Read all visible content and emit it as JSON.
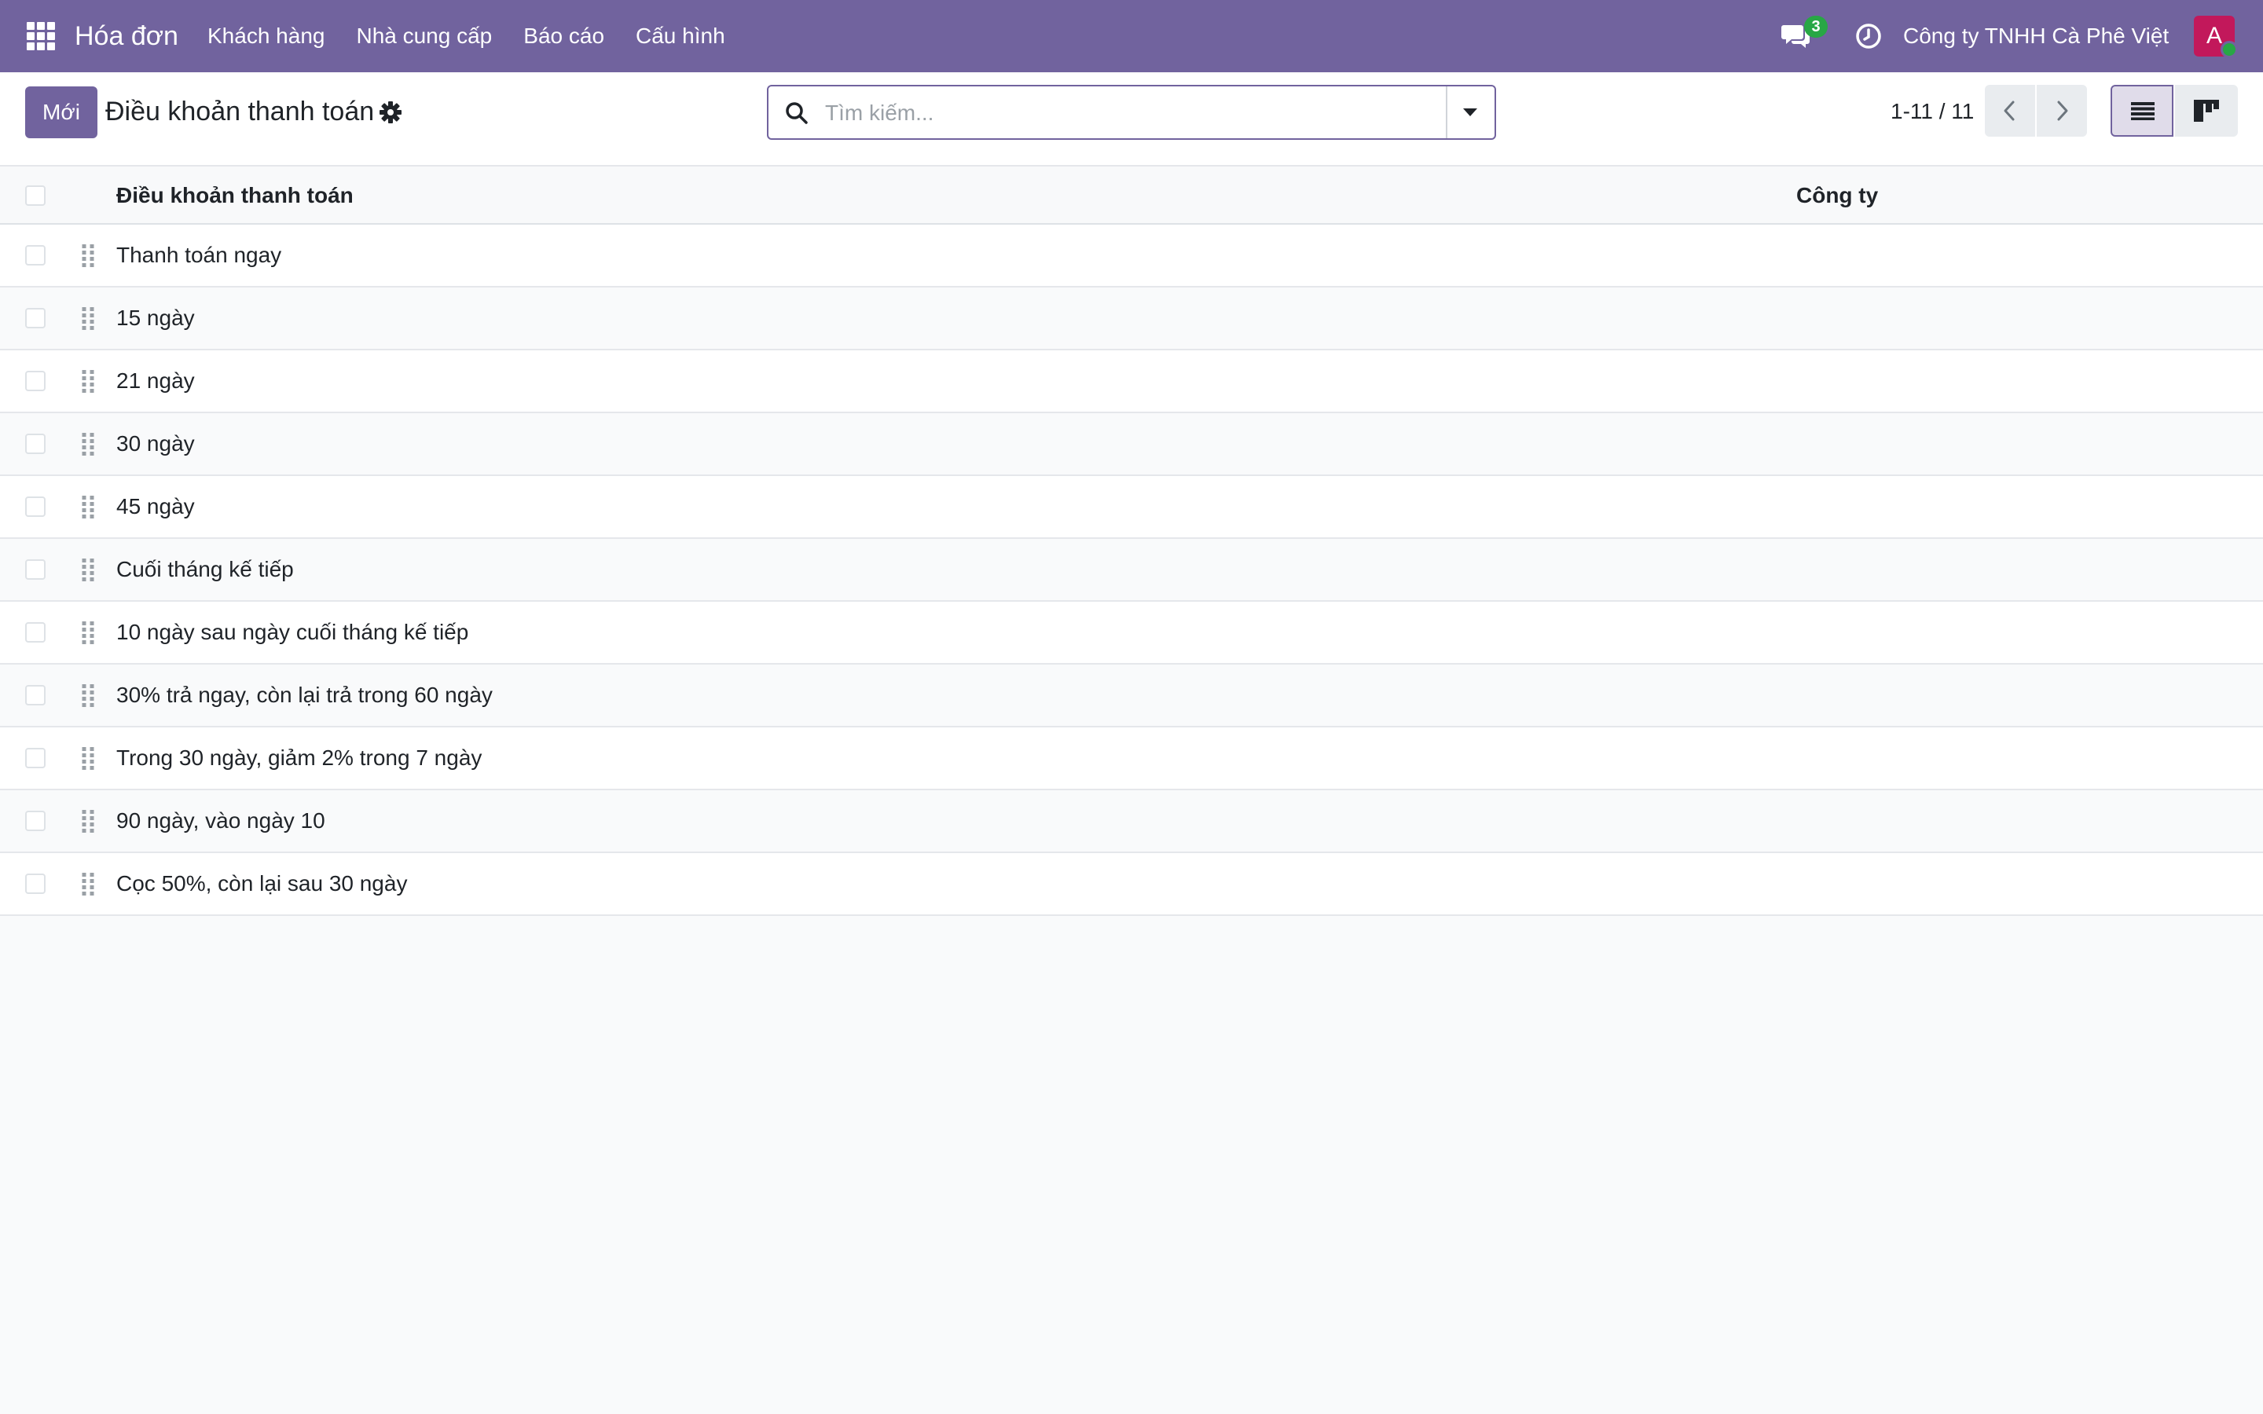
{
  "navbar": {
    "brand": "Hóa đơn",
    "menu": [
      {
        "label": "Khách hàng"
      },
      {
        "label": "Nhà cung cấp"
      },
      {
        "label": "Báo cáo"
      },
      {
        "label": "Cấu hình"
      }
    ],
    "chat_count": "3",
    "company": "Công ty TNHH Cà Phê Việt",
    "avatar_initial": "A",
    "colors": {
      "bar": "#71639e",
      "avatar": "#c2185b",
      "status": "#28a745"
    }
  },
  "control_panel": {
    "new_button": "Mới",
    "title": "Điều khoản thanh toán",
    "search_placeholder": "Tìm kiếm...",
    "pager": "1-11 / 11"
  },
  "table": {
    "columns": [
      "Điều khoản thanh toán",
      "Công ty"
    ],
    "rows": [
      {
        "name": "Thanh toán ngay",
        "company": ""
      },
      {
        "name": "15 ngày",
        "company": ""
      },
      {
        "name": "21 ngày",
        "company": ""
      },
      {
        "name": "30 ngày",
        "company": ""
      },
      {
        "name": "45 ngày",
        "company": ""
      },
      {
        "name": "Cuối tháng kế tiếp",
        "company": ""
      },
      {
        "name": "10 ngày sau ngày cuối tháng kế tiếp",
        "company": ""
      },
      {
        "name": "30% trả ngay, còn lại trả trong 60 ngày",
        "company": ""
      },
      {
        "name": "Trong 30 ngày, giảm 2% trong 7 ngày",
        "company": ""
      },
      {
        "name": "90 ngày, vào ngày 10",
        "company": ""
      },
      {
        "name": "Cọc 50%, còn lại sau 30 ngày",
        "company": ""
      }
    ]
  }
}
